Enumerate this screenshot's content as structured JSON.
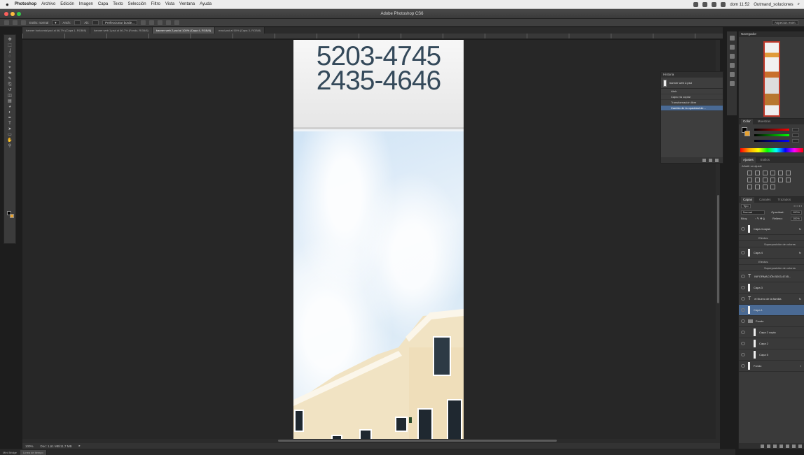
{
  "menubar": {
    "apple_icon": "apple-icon",
    "items": [
      "Photoshop",
      "Archivo",
      "Edición",
      "Imagen",
      "Capa",
      "Texto",
      "Selección",
      "Filtro",
      "Vista",
      "Ventana",
      "Ayuda"
    ],
    "clock": "dom 11:52",
    "user": "Outmand_soluciones"
  },
  "window": {
    "title": "Adobe Photoshop CS6",
    "traffic_colors": [
      "#fc605c",
      "#fdbc40",
      "#34c84a"
    ]
  },
  "options": {
    "tool_preset": "",
    "style_label": "Estilo: normal",
    "width_label": "Anch:",
    "height_label": "Alt:",
    "refine_label": "Perfeccionar borde...",
    "workspace": "Aspectos esen."
  },
  "tabs": [
    {
      "label": "banner horizontal.psd al 66,7% (Capa 1, RGB/8)",
      "active": false
    },
    {
      "label": "banner web 1.psd al 66,7% (Fondo, RGB/8)",
      "active": false
    },
    {
      "label": "banner web 2.psd al 100% (Capa 4, RGB/8)",
      "active": true
    },
    {
      "label": "masi.psd al 50% (Capa 3, RGB/8)",
      "active": false
    }
  ],
  "document": {
    "phone_1": "5203-4745",
    "phone_2": "2435-4646"
  },
  "status": {
    "zoom": "100%",
    "doc_info": "Doc: 1,61 MB/11,7 MB"
  },
  "minibridge": {
    "label": "Mini Bridge",
    "timeline": "Línea de tiempo"
  },
  "history": {
    "title": "Historia",
    "snapshot": "banner web 2.psd",
    "items": [
      {
        "label": "Abrir",
        "selected": false
      },
      {
        "label": "Capa vía copiar",
        "selected": false
      },
      {
        "label": "Transformación libre",
        "selected": false
      },
      {
        "label": "Cambio de la opacidad de...",
        "selected": true
      }
    ]
  },
  "dock": {
    "navigator_title": "Navegador",
    "color_tabs": [
      "Color",
      "Muestras"
    ],
    "color_values": {
      "r": "0",
      "g": "0",
      "b": "0"
    },
    "adjust_tabs": [
      "Ajustes",
      "Estilos"
    ],
    "adjust_hint": "Añadir un ajuste",
    "layer_tabs": [
      "Capas",
      "Canales",
      "Trazados"
    ],
    "filter_kind": "Tipo",
    "blend_mode": "Normal",
    "opacity_label": "Opacidad:",
    "opacity_value": "100%",
    "lock_label": "Bloq:",
    "fill_label": "Relleno:",
    "fill_value": "100%",
    "layers": [
      {
        "kind": "pixel",
        "label": "Capa 4 copia",
        "fx": true,
        "selected": false,
        "indent": 0
      },
      {
        "kind": "sub",
        "label": "Efectos",
        "indent": 1
      },
      {
        "kind": "sub",
        "label": "Superposición de colores",
        "indent": 2
      },
      {
        "kind": "pixel",
        "label": "Capa 4",
        "fx": true,
        "selected": false,
        "indent": 0
      },
      {
        "kind": "sub",
        "label": "Efectos",
        "indent": 1
      },
      {
        "kind": "sub",
        "label": "Superposición de colores",
        "indent": 2
      },
      {
        "kind": "text",
        "label": "INFORMACIÓN 5203-4745...",
        "fx": false,
        "selected": false,
        "indent": 0
      },
      {
        "kind": "pixel",
        "label": "Capa 3",
        "fx": false,
        "selected": false,
        "indent": 0
      },
      {
        "kind": "text",
        "label": "el Nuevo de la familia",
        "fx": true,
        "selected": false,
        "indent": 0
      },
      {
        "kind": "pixel",
        "label": "Capa 1",
        "fx": false,
        "selected": true,
        "indent": 0
      },
      {
        "kind": "group",
        "label": "Fondo",
        "fx": false,
        "selected": false,
        "indent": 0
      },
      {
        "kind": "pixel",
        "label": "Capa 2 copia",
        "fx": false,
        "selected": false,
        "indent": 1
      },
      {
        "kind": "pixel",
        "label": "Capa 2",
        "fx": false,
        "selected": false,
        "indent": 1
      },
      {
        "kind": "pixel",
        "label": "Capa 5",
        "fx": false,
        "selected": false,
        "indent": 1
      },
      {
        "kind": "pixel",
        "label": "Fondo",
        "fx": false,
        "selected": false,
        "indent": 0,
        "locked": true
      }
    ]
  },
  "tools": [
    "move-icon",
    "marquee-icon",
    "lasso-icon",
    "quick-select-icon",
    "crop-icon",
    "eyedropper-icon",
    "healing-icon",
    "brush-icon",
    "clone-stamp-icon",
    "history-brush-icon",
    "eraser-icon",
    "gradient-icon",
    "blur-icon",
    "dodge-icon",
    "pen-icon",
    "type-icon",
    "path-select-icon",
    "shape-icon",
    "hand-icon",
    "zoom-icon"
  ],
  "colors": {
    "foreground": "#000000",
    "background": "#e8a330",
    "selection": "#4a6a94"
  }
}
